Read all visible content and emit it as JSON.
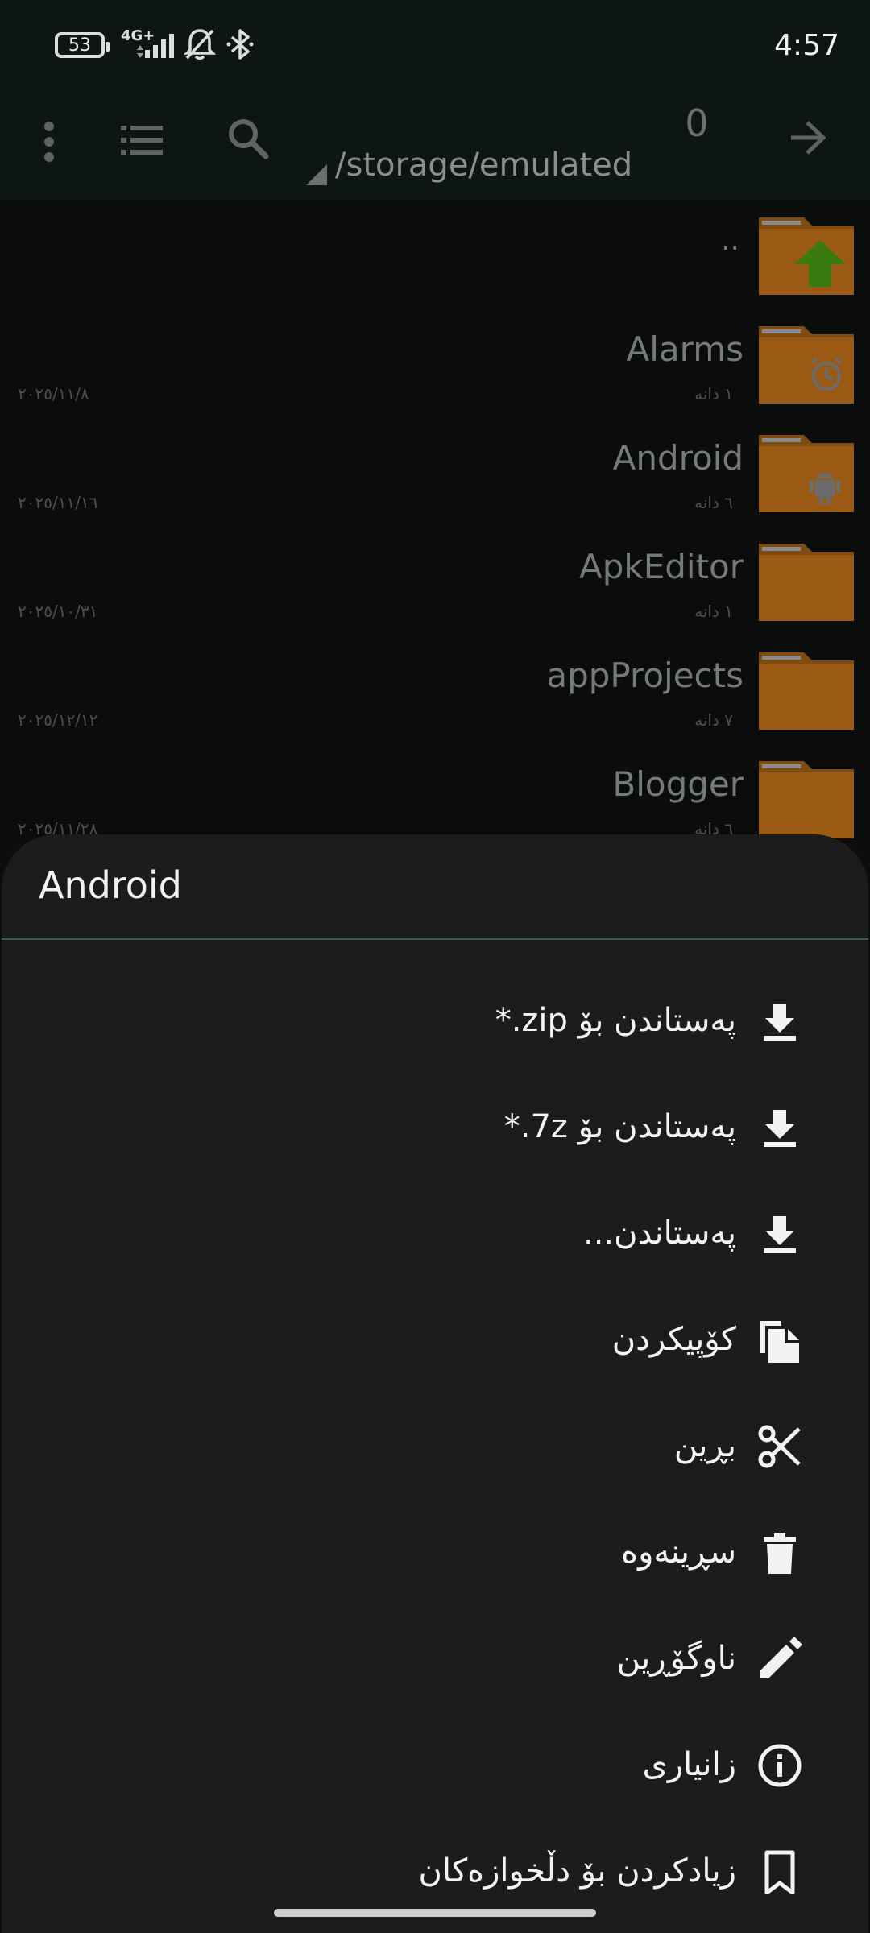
{
  "status_bar": {
    "battery": "53",
    "network": "4G+",
    "time": "4:57"
  },
  "toolbar": {
    "selected_count": "0",
    "path": "/storage/emulated"
  },
  "files": [
    {
      "name": "..",
      "count": "",
      "date": ""
    },
    {
      "name": "Alarms",
      "count": "١ دانە",
      "date": "٢٠٢٥/١١/٨"
    },
    {
      "name": "Android",
      "count": "٦ دانە",
      "date": "٢٠٢٥/١١/١٦"
    },
    {
      "name": "ApkEditor",
      "count": "١ دانە",
      "date": "٢٠٢٥/١٠/٣١"
    },
    {
      "name": "appProjects",
      "count": "٧ دانە",
      "date": "٢٠٢٥/١٢/١٢"
    },
    {
      "name": "Blogger",
      "count": "٦ دانە",
      "date": "٢٠٢٥/١١/٢٨"
    }
  ],
  "sheet": {
    "title": "Android",
    "items": [
      {
        "label": "پەستاندن بۆ ‎*.zip",
        "icon": "download-icon"
      },
      {
        "label": "پەستاندن بۆ ‎*.7z",
        "icon": "download-icon"
      },
      {
        "label": "پەستاندن...",
        "icon": "download-icon"
      },
      {
        "label": "کۆپیکردن",
        "icon": "copy-icon"
      },
      {
        "label": "بڕین",
        "icon": "scissors-icon"
      },
      {
        "label": "سڕینەوە",
        "icon": "trash-icon"
      },
      {
        "label": "ناوگۆڕین",
        "icon": "pencil-icon"
      },
      {
        "label": "زانیاری",
        "icon": "info-icon"
      },
      {
        "label": "زیادکردن بۆ دڵخوازەکان",
        "icon": "bookmark-icon"
      }
    ]
  },
  "colors": {
    "folder": "#9b5a14",
    "up_arrow": "#3b7a10",
    "sheet_bg": "#1b1c1c",
    "divider": "#3c5b57"
  }
}
